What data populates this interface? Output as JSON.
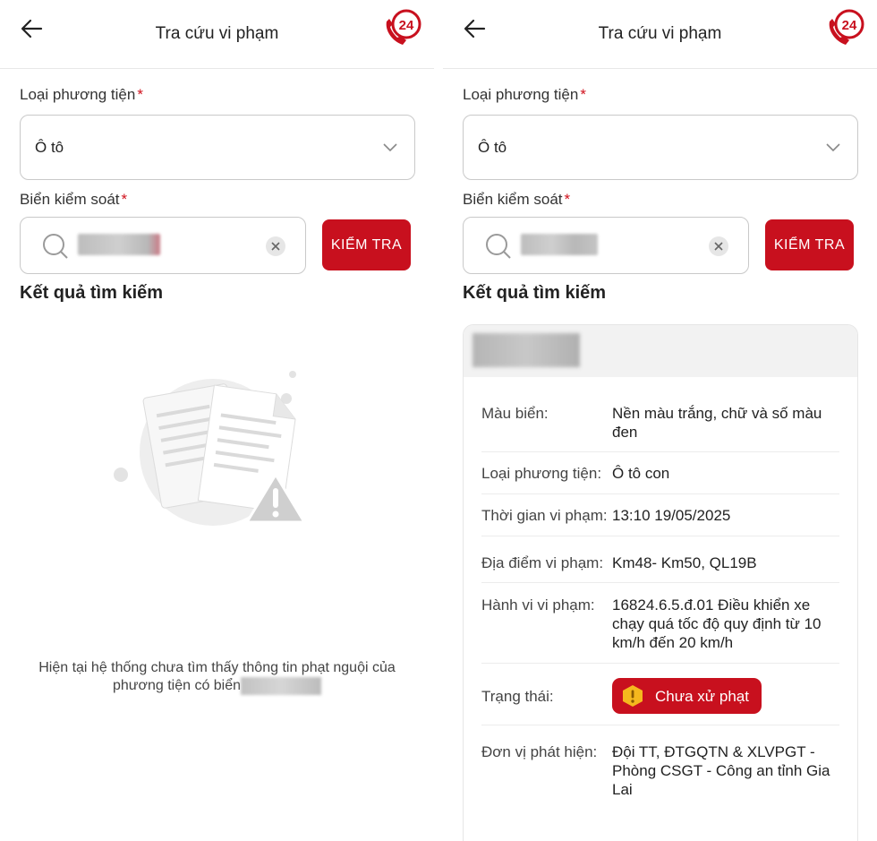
{
  "screens": [
    {
      "header": {
        "title": "Tra cứu vi phạm",
        "hotline_badge": "24"
      },
      "vehicle_type": {
        "label": "Loại phương tiện",
        "required_mark": "*",
        "selected": "Ô tô"
      },
      "plate": {
        "label": "Biển kiểm soát",
        "required_mark": "*",
        "value_redacted": true
      },
      "check_button": "KIỂM TRA",
      "results": {
        "title": "Kết quả tìm kiếm",
        "empty_message": "Hiện tại hệ thống chưa tìm thấy thông tin phạt nguội của phương tiện có biển"
      }
    },
    {
      "header": {
        "title": "Tra cứu vi phạm",
        "hotline_badge": "24"
      },
      "vehicle_type": {
        "label": "Loại phương tiện",
        "required_mark": "*",
        "selected": "Ô tô"
      },
      "plate": {
        "label": "Biển kiểm soát",
        "required_mark": "*",
        "value_redacted": true
      },
      "check_button": "KIỂM TRA",
      "results": {
        "title": "Kết quả tìm kiếm",
        "violation": {
          "plate_redacted": true,
          "rows": [
            {
              "key": "Màu biển:",
              "value": "Nền màu trắng, chữ và số màu đen"
            },
            {
              "key": "Loại phương tiện:",
              "value": "Ô tô con"
            },
            {
              "key": "Thời gian vi phạm:",
              "value": "13:10 19/05/2025"
            },
            {
              "key": "Địa điểm vi phạm:",
              "value": "Km48- Km50, QL19B"
            },
            {
              "key": "Hành vi vi phạm:",
              "value": "16824.6.5.đ.01 Điều khiển xe chạy quá tốc độ quy định từ 10 km/h đến 20 km/h"
            },
            {
              "key": "Trạng thái:",
              "value": "Chưa xử phạt"
            },
            {
              "key": "Đơn vị phát hiện:",
              "value": "Đội TT, ĐTGQTN & XLVPGT - Phòng CSGT - Công an tỉnh Gia Lai"
            }
          ]
        }
      }
    }
  ],
  "colors": {
    "primary_red": "#c8101e",
    "required_red": "#d0101b",
    "warning_yellow": "#f5b81e"
  },
  "icons": [
    "back-arrow-icon",
    "hotline-24-icon",
    "chevron-down-icon",
    "search-icon",
    "clear-icon",
    "empty-document-warning-icon",
    "warning-icon"
  ]
}
